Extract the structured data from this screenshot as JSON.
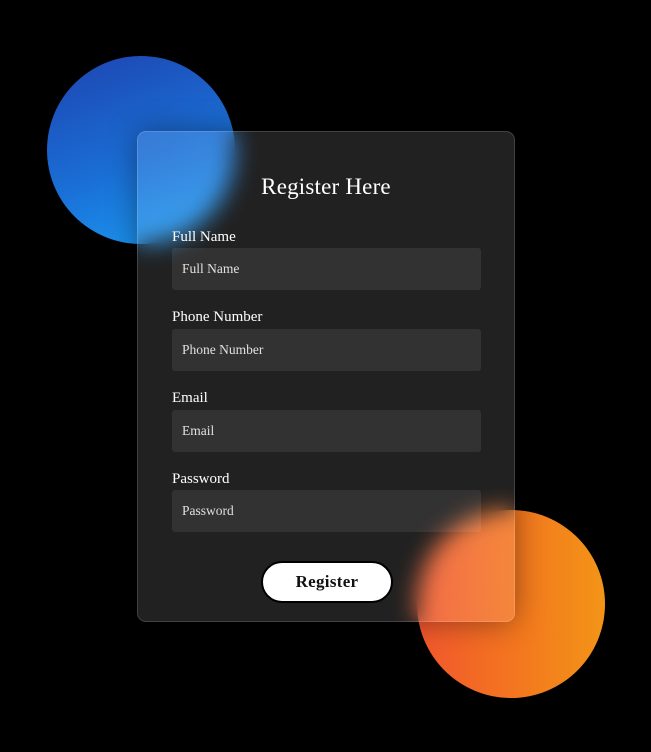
{
  "form": {
    "title": "Register Here",
    "fields": [
      {
        "label": "Full Name",
        "placeholder": "Full Name",
        "type": "text"
      },
      {
        "label": "Phone Number",
        "placeholder": "Phone Number",
        "type": "tel"
      },
      {
        "label": "Email",
        "placeholder": "Email",
        "type": "email"
      },
      {
        "label": "Password",
        "placeholder": "Password",
        "type": "password"
      }
    ],
    "submit_label": "Register"
  },
  "theme": {
    "background": "#000000",
    "blue_circle_colors": [
      "#1e44b0",
      "#1b9ff5"
    ],
    "orange_circle_colors": [
      "#f2562e",
      "#f39417"
    ],
    "button_background": "#ffffff"
  }
}
